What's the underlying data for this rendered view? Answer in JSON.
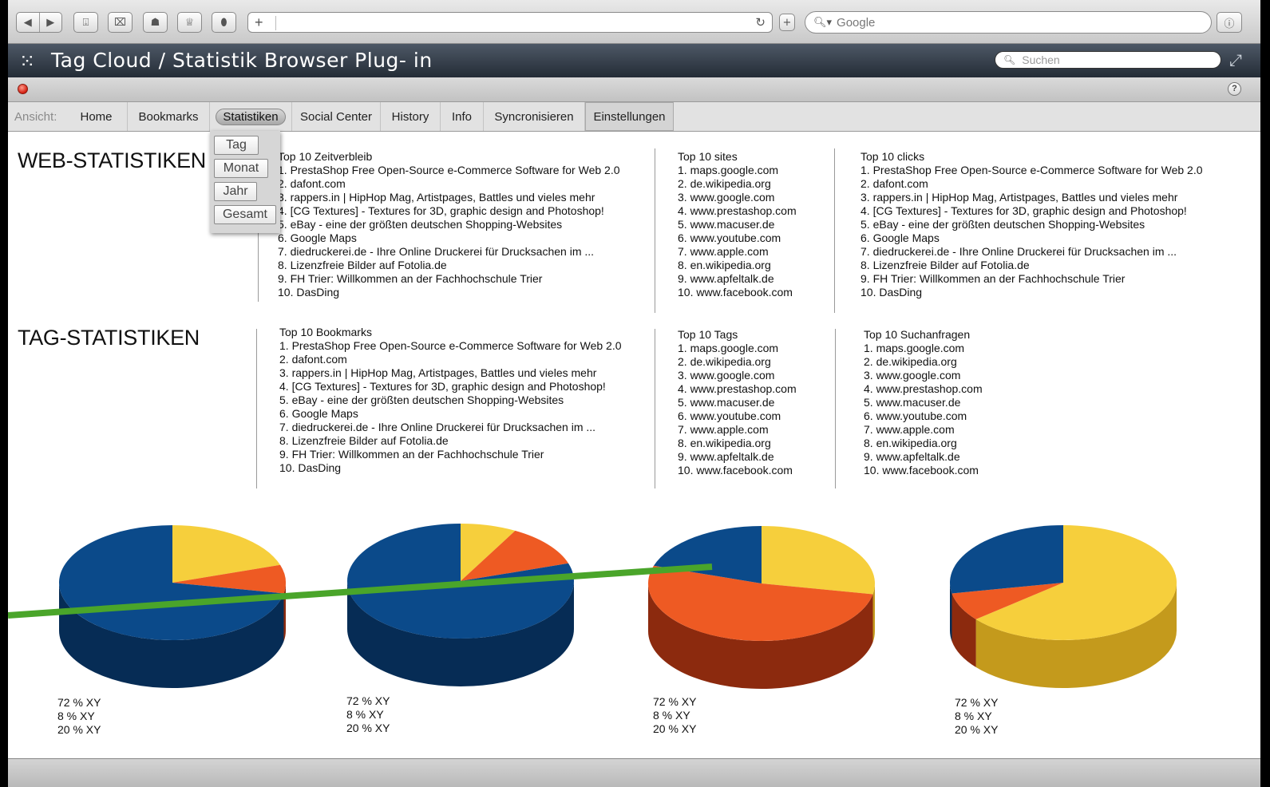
{
  "browser": {
    "search_placeholder": "Google"
  },
  "app": {
    "title": "Tag Cloud / Statistik Browser Plug- in",
    "search_placeholder": "Suchen"
  },
  "nav": {
    "label": "Ansicht:",
    "items": [
      "Home",
      "Bookmarks",
      "Statistiken",
      "Social Center",
      "History",
      "Info",
      "Syncronisieren",
      "Einstellungen"
    ],
    "active": "Statistiken"
  },
  "dropdown": {
    "items": [
      "Tag",
      "Monat",
      "Jahr",
      "Gesamt"
    ]
  },
  "web_stats": {
    "title": "WEB-STATISTIKEN",
    "zeitverbleib": {
      "heading": "Top 10 Zeitverbleib",
      "items": [
        "1. PrestaShop Free Open-Source e-Commerce Software for Web 2.0",
        "2. dafont.com",
        "3. rappers.in | HipHop Mag, Artistpages, Battles und vieles mehr",
        "4. [CG Textures] - Textures for 3D, graphic design and Photoshop!",
        "5. eBay - eine der größten deutschen Shopping-Websites",
        "6. Google Maps",
        "7. diedruckerei.de - Ihre Online Druckerei für Drucksachen im ...",
        "8. Lizenzfreie Bilder auf Fotolia.de",
        "9. FH Trier: Willkommen an der Fachhochschule Trier",
        "10. DasDing"
      ]
    },
    "sites": {
      "heading": "Top 10 sites",
      "items": [
        "1. maps.google.com",
        "2. de.wikipedia.org",
        "3. www.google.com",
        "4. www.prestashop.com",
        "5. www.macuser.de",
        "6. www.youtube.com",
        "7. www.apple.com",
        "8. en.wikipedia.org",
        "9. www.apfeltalk.de",
        "10. www.facebook.com"
      ]
    },
    "clicks": {
      "heading": "Top 10 clicks",
      "items": [
        "1. PrestaShop Free Open-Source e-Commerce Software for Web 2.0",
        "2. dafont.com",
        "3. rappers.in | HipHop Mag, Artistpages, Battles und vieles mehr",
        "4. [CG Textures] - Textures for 3D, graphic design and Photoshop!",
        "5. eBay - eine der größten deutschen Shopping-Websites",
        "6. Google Maps",
        "7. diedruckerei.de - Ihre Online Druckerei für Drucksachen im ...",
        "8. Lizenzfreie Bilder auf Fotolia.de",
        "9. FH Trier: Willkommen an der Fachhochschule Trier",
        "10. DasDing"
      ]
    }
  },
  "tag_stats": {
    "title": "TAG-STATISTIKEN",
    "bookmarks": {
      "heading": "Top 10 Bookmarks",
      "items": [
        "1. PrestaShop Free Open-Source e-Commerce Software for Web 2.0",
        "2. dafont.com",
        "3. rappers.in | HipHop Mag, Artistpages, Battles und vieles mehr",
        "4. [CG Textures] - Textures for 3D, graphic design and Photoshop!",
        "5. eBay - eine der größten deutschen Shopping-Websites",
        "6. Google Maps",
        "7. diedruckerei.de - Ihre Online Druckerei für Drucksachen im ...",
        "8. Lizenzfreie Bilder auf Fotolia.de",
        "9. FH Trier: Willkommen an der Fachhochschule Trier",
        "10. DasDing"
      ]
    },
    "tags": {
      "heading": "Top 10 Tags",
      "items": [
        "1. maps.google.com",
        "2. de.wikipedia.org",
        "3. www.google.com",
        "4. www.prestashop.com",
        "5. www.macuser.de",
        "6. www.youtube.com",
        "7. www.apple.com",
        "8. en.wikipedia.org",
        "9. www.apfeltalk.de",
        "10. www.facebook.com"
      ]
    },
    "suchanfragen": {
      "heading": "Top 10 Suchanfragen",
      "items": [
        "1. maps.google.com",
        "2. de.wikipedia.org",
        "3. www.google.com",
        "4. www.prestashop.com",
        "5. www.macuser.de",
        "6. www.youtube.com",
        "7. www.apple.com",
        "8. en.wikipedia.org",
        "9. www.apfeltalk.de",
        "10. www.facebook.com"
      ]
    }
  },
  "colors": {
    "blue": "#0b4a8a",
    "orange": "#ee5a23",
    "yellow": "#f6cf3c",
    "annotation_green": "#4aa52a"
  },
  "pies": [
    {
      "legend": [
        "72 % XY",
        "8 % XY",
        "20 % XY"
      ],
      "slices": [
        {
          "color": "yellow",
          "value": 20
        },
        {
          "color": "orange",
          "value": 8
        },
        {
          "color": "blue",
          "value": 72
        }
      ]
    },
    {
      "legend": [
        "72 % XY",
        "8 % XY",
        "20 % XY"
      ],
      "slices": [
        {
          "color": "yellow",
          "value": 8
        },
        {
          "color": "orange",
          "value": 12
        },
        {
          "color": "blue",
          "value": 80
        }
      ]
    },
    {
      "legend": [
        "72 % XY",
        "8 % XY",
        "20 % XY"
      ],
      "slices": [
        {
          "color": "yellow",
          "value": 28
        },
        {
          "color": "orange",
          "value": 52
        },
        {
          "color": "blue",
          "value": 20
        }
      ]
    },
    {
      "legend": [
        "72 % XY",
        "8 % XY",
        "20 % XY"
      ],
      "slices": [
        {
          "color": "yellow",
          "value": 64
        },
        {
          "color": "orange",
          "value": 8
        },
        {
          "color": "blue",
          "value": 28
        }
      ]
    }
  ]
}
